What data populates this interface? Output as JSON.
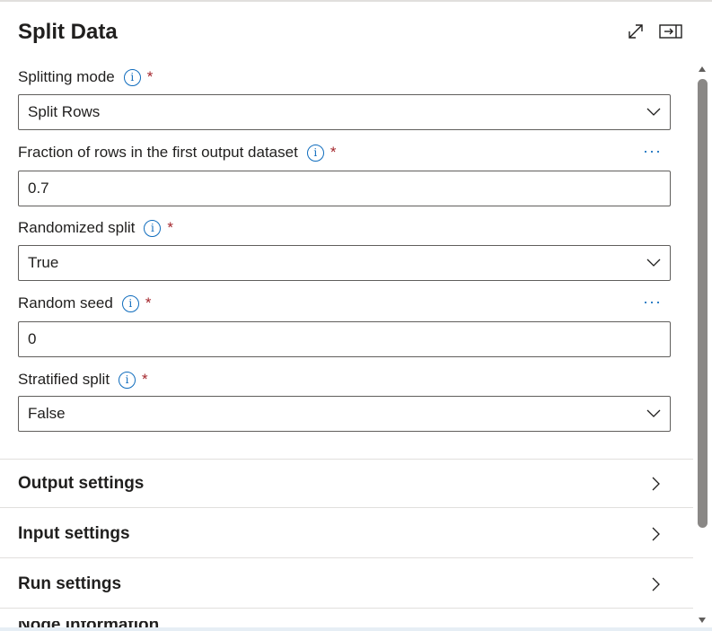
{
  "panel": {
    "title": "Split Data"
  },
  "fields": {
    "splitting_mode": {
      "label": "Splitting mode",
      "required": "*",
      "value": "Split Rows"
    },
    "fraction": {
      "label": "Fraction of rows in the first output dataset",
      "required": "*",
      "value": "0.7",
      "more": "···"
    },
    "randomized_split": {
      "label": "Randomized split",
      "required": "*",
      "value": "True"
    },
    "random_seed": {
      "label": "Random seed",
      "required": "*",
      "value": "0",
      "more": "···"
    },
    "stratified_split": {
      "label": "Stratified split",
      "required": "*",
      "value": "False"
    }
  },
  "info_glyph": "i",
  "sections": [
    {
      "label": "Output settings"
    },
    {
      "label": "Input settings"
    },
    {
      "label": "Run settings"
    },
    {
      "label": "Node information"
    }
  ],
  "icons": {
    "expand": "expand-icon",
    "dock": "dock-panel-icon",
    "info": "info-icon",
    "chevron_down": "chevron-down-icon",
    "chevron_right": "chevron-right-icon"
  },
  "colors": {
    "accent": "#0f6cbd",
    "required": "#a4262c",
    "scroll_thumb": "#8a8886"
  }
}
